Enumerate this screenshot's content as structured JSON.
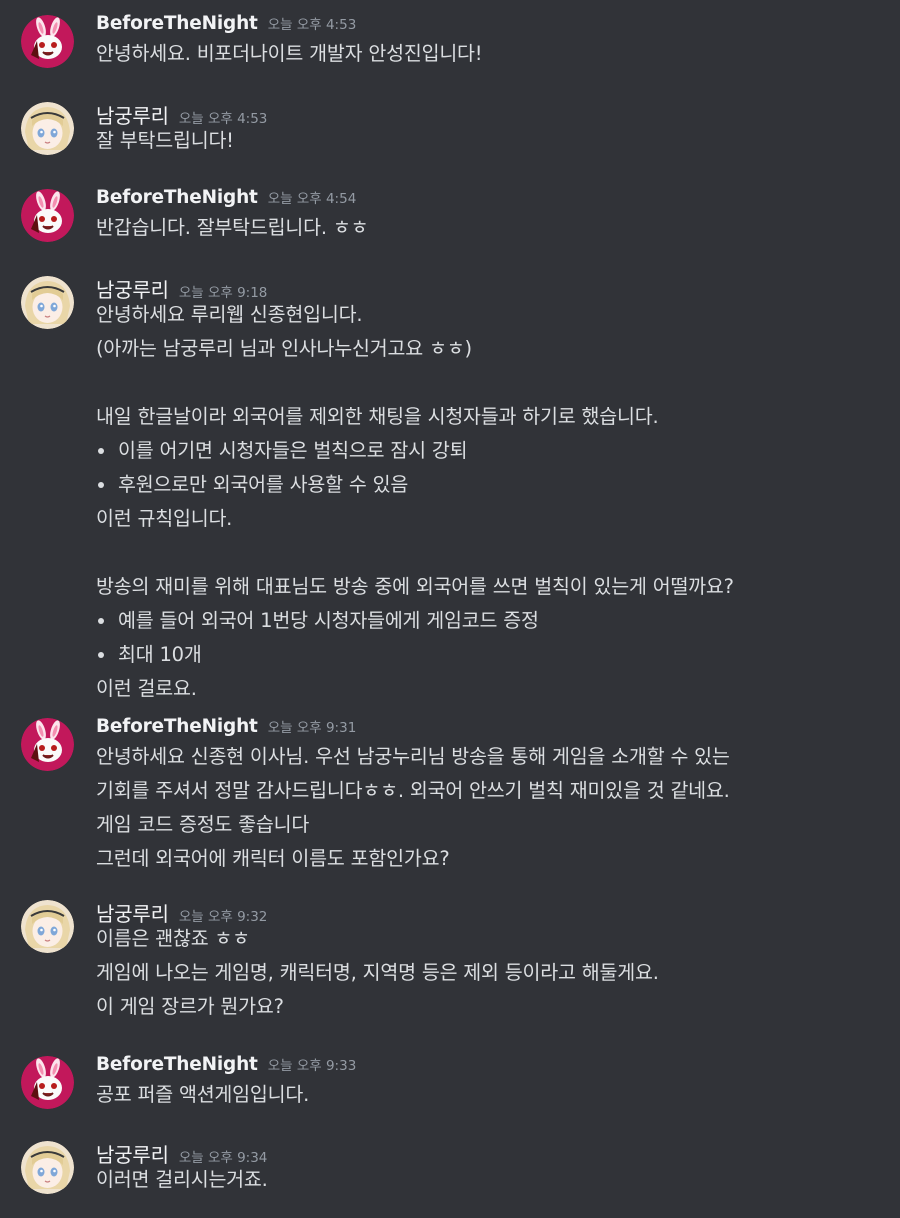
{
  "messages": [
    {
      "author": "BeforeTheNight",
      "avatar": "bunny-avatar",
      "time": "오늘 오후 4:53",
      "lines": [
        {
          "type": "text",
          "text": "안녕하세요. 비포더나이트 개발자 안성진입니다!"
        }
      ]
    },
    {
      "author": "남궁루리",
      "avatar": "anime-girl-avatar",
      "time": "오늘 오후 4:53",
      "lines": [
        {
          "type": "text",
          "text": "잘 부탁드립니다!"
        }
      ]
    },
    {
      "author": "BeforeTheNight",
      "avatar": "bunny-avatar",
      "time": "오늘 오후 4:54",
      "lines": [
        {
          "type": "text",
          "text": "반갑습니다. 잘부탁드립니다. ㅎㅎ"
        }
      ]
    },
    {
      "author": "남궁루리",
      "avatar": "anime-girl-avatar",
      "time": "오늘 오후 9:18",
      "lines": [
        {
          "type": "text",
          "text": "안녕하세요 루리웹 신종현입니다."
        },
        {
          "type": "text",
          "text": "(아까는 남궁루리 님과 인사나누신거고요 ㅎㅎ)"
        },
        {
          "type": "blank",
          "text": ""
        },
        {
          "type": "text",
          "text": "내일 한글날이라 외국어를 제외한 채팅을 시청자들과 하기로 했습니다."
        },
        {
          "type": "bullet",
          "text": "이를 어기면 시청자들은 벌칙으로 잠시 강퇴"
        },
        {
          "type": "bullet",
          "text": "후원으로만 외국어를 사용할 수 있음"
        },
        {
          "type": "text",
          "text": "이런 규칙입니다."
        },
        {
          "type": "blank",
          "text": ""
        },
        {
          "type": "text",
          "text": "방송의 재미를 위해 대표님도 방송 중에 외국어를 쓰면 벌칙이 있는게 어떨까요?"
        },
        {
          "type": "bullet",
          "text": "예를 들어 외국어 1번당 시청자들에게 게임코드 증정"
        },
        {
          "type": "bullet",
          "text": "최대 10개"
        },
        {
          "type": "text",
          "text": "이런 걸로요."
        }
      ]
    },
    {
      "author": "BeforeTheNight",
      "avatar": "bunny-avatar",
      "time": "오늘 오후 9:31",
      "lines": [
        {
          "type": "text",
          "text": "안녕하세요 신종현 이사님. 우선 남궁누리님 방송을 통해 게임을 소개할 수 있는"
        },
        {
          "type": "text",
          "text": "기회를 주셔서 정말 감사드립니다ㅎㅎ. 외국어 안쓰기 벌칙 재미있을 것 같네요."
        },
        {
          "type": "text",
          "text": "게임 코드 증정도 좋습니다"
        },
        {
          "type": "text",
          "text": "그런데 외국어에 캐릭터 이름도 포함인가요?"
        }
      ]
    },
    {
      "author": "남궁루리",
      "avatar": "anime-girl-avatar",
      "time": "오늘 오후 9:32",
      "lines": [
        {
          "type": "text",
          "text": "이름은 괜찮죠 ㅎㅎ"
        },
        {
          "type": "text",
          "text": "게임에 나오는 게임명, 캐릭터명, 지역명 등은 제외 등이라고 해둘게요."
        },
        {
          "type": "text",
          "text": "이 게임 장르가 뭔가요?"
        }
      ]
    },
    {
      "author": "BeforeTheNight",
      "avatar": "bunny-avatar",
      "time": "오늘 오후 9:33",
      "lines": [
        {
          "type": "text",
          "text": "공포 퍼즐 액션게임입니다."
        }
      ]
    },
    {
      "author": "남궁루리",
      "avatar": "anime-girl-avatar",
      "time": "오늘 오후 9:34",
      "lines": [
        {
          "type": "text",
          "text": "이러면 걸리시는거죠."
        }
      ]
    }
  ]
}
